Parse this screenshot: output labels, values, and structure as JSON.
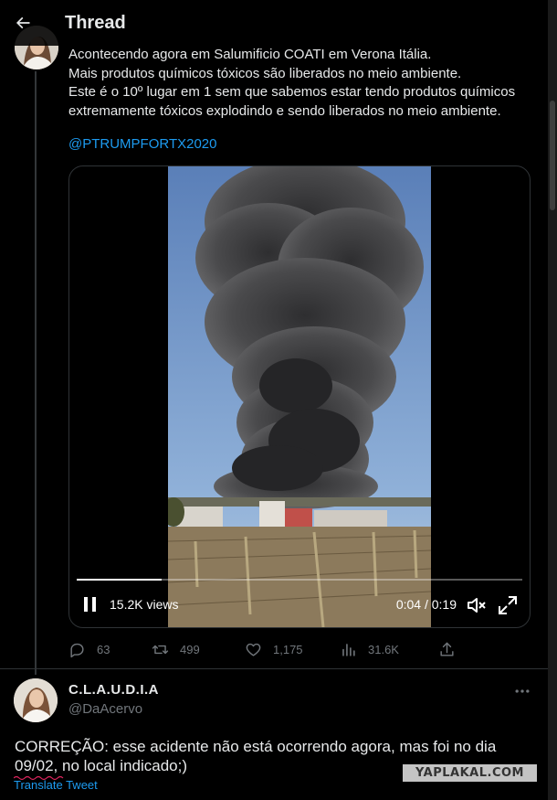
{
  "header": {
    "title": "Thread"
  },
  "tweet": {
    "text_lines": [
      "Acontecendo agora em Salumificio COATI em Verona Itália.",
      "Mais produtos químicos tóxicos são liberados no meio ambiente.",
      "Este é o 10º lugar em 1 sem que sabemos estar tendo produtos químicos",
      "extremamente tóxicos explodindo e sendo liberados no meio ambiente."
    ],
    "mention": "@PTRUMPFORTX2020",
    "video": {
      "views": "15.2K views",
      "time": "0:04 / 0:19",
      "progress": 0.19
    },
    "actions": {
      "replies": "63",
      "retweets": "499",
      "likes": "1,175",
      "views": "31.6K"
    }
  },
  "reply": {
    "name": "C.L.A.U.D.I.A",
    "handle": "@DaAcervo",
    "text_line1": "CORREÇÃO: esse acidente não está ocorrendo agora, mas foi no dia",
    "text_line2": "09/02, no local indicado;)",
    "translate": "Translate Tweet"
  },
  "watermark": "YAPLAKAL.COM",
  "colors": {
    "background": "#000000",
    "text": "#e7e9ea",
    "secondary": "#71767b",
    "accent": "#1d9bf0",
    "border": "#2f3336"
  }
}
